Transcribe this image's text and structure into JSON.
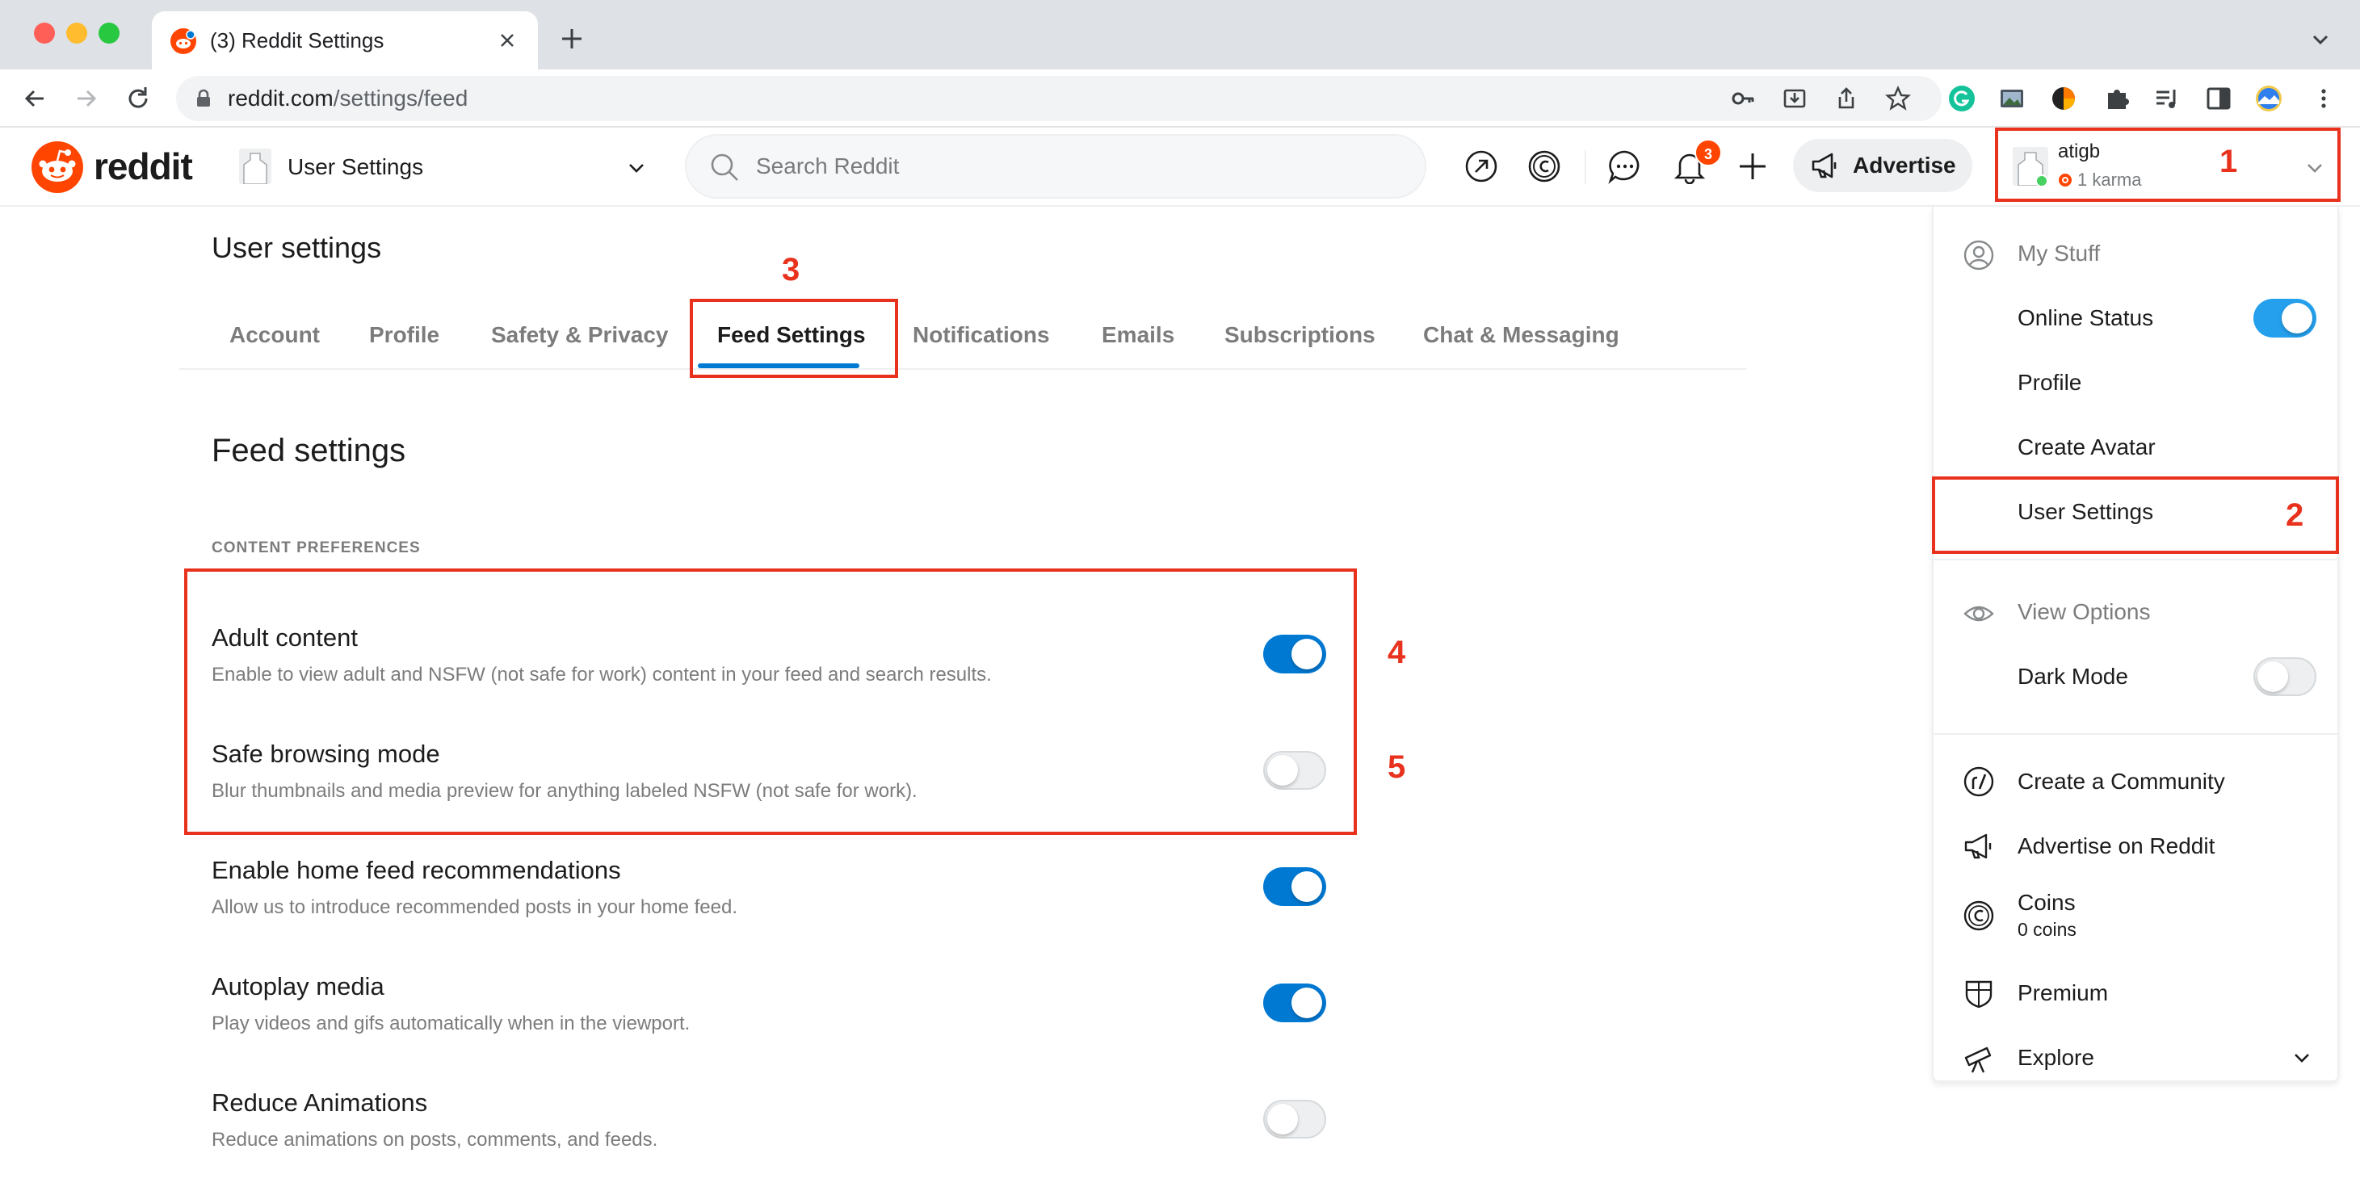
{
  "browser": {
    "tab_title": "(3) Reddit Settings",
    "url_host": "reddit.com",
    "url_path": "/settings/feed"
  },
  "header": {
    "logo_text": "reddit",
    "community_label": "User Settings",
    "search_placeholder": "Search Reddit",
    "notification_count": "3",
    "advertise_label": "Advertise",
    "username": "atigb",
    "karma": "1 karma"
  },
  "settings": {
    "page_title": "User settings",
    "tabs": [
      {
        "label": "Account"
      },
      {
        "label": "Profile"
      },
      {
        "label": "Safety & Privacy"
      },
      {
        "label": "Feed Settings"
      },
      {
        "label": "Notifications"
      },
      {
        "label": "Emails"
      },
      {
        "label": "Subscriptions"
      },
      {
        "label": "Chat & Messaging"
      }
    ],
    "active_tab": "Feed Settings",
    "heading": "Feed settings",
    "section_label": "CONTENT PREFERENCES",
    "rows": [
      {
        "title": "Adult content",
        "description": "Enable to view adult and NSFW (not safe for work) content in your feed and search results.",
        "enabled": true
      },
      {
        "title": "Safe browsing mode",
        "description": "Blur thumbnails and media preview for anything labeled NSFW (not safe for work).",
        "enabled": false
      },
      {
        "title": "Enable home feed recommendations",
        "description": "Allow us to introduce recommended posts in your home feed.",
        "enabled": true
      },
      {
        "title": "Autoplay media",
        "description": "Play videos and gifs automatically when in the viewport.",
        "enabled": true
      },
      {
        "title": "Reduce Animations",
        "description": "Reduce animations on posts, comments, and feeds.",
        "enabled": false
      }
    ]
  },
  "menu": {
    "my_stuff": "My Stuff",
    "online_status": "Online Status",
    "online_status_on": true,
    "profile": "Profile",
    "create_avatar": "Create Avatar",
    "user_settings": "User Settings",
    "view_options": "View Options",
    "dark_mode": "Dark Mode",
    "dark_mode_on": false,
    "create_community": "Create a Community",
    "advertise_on_reddit": "Advertise on Reddit",
    "coins": "Coins",
    "coins_sub": "0 coins",
    "premium": "Premium",
    "explore": "Explore"
  },
  "annotations": [
    "1",
    "2",
    "3",
    "4",
    "5"
  ],
  "colors": {
    "accent_blue": "#0079d3",
    "brand_orange": "#ff4500",
    "annotation_red": "#e8321e"
  }
}
